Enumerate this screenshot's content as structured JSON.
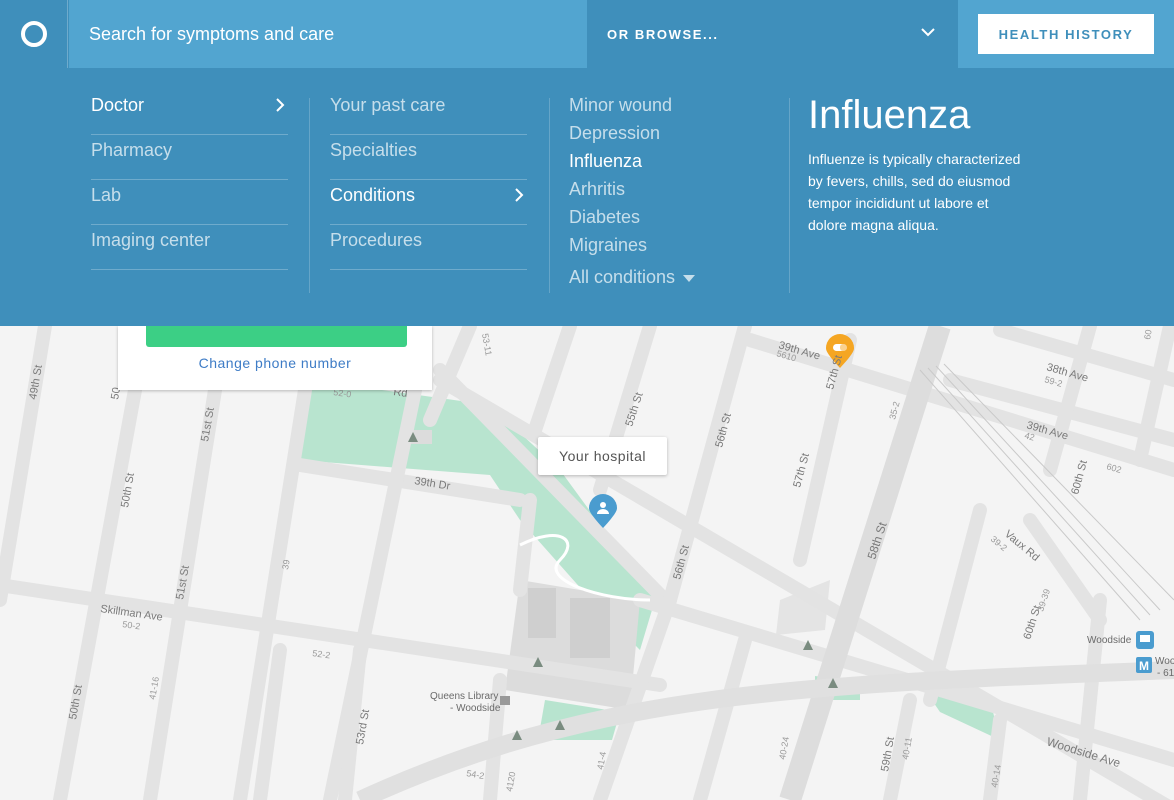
{
  "header": {
    "search_placeholder": "Search for symptoms and care",
    "browse_label": "OR BROWSE...",
    "history_button": "HEALTH HISTORY"
  },
  "menu": {
    "care_types": [
      {
        "label": "Doctor",
        "active": true
      },
      {
        "label": "Pharmacy",
        "active": false
      },
      {
        "label": "Lab",
        "active": false
      },
      {
        "label": "Imaging center",
        "active": false
      }
    ],
    "doctor_options": [
      {
        "label": "Your past care",
        "active": false
      },
      {
        "label": "Specialties",
        "active": false
      },
      {
        "label": "Conditions",
        "active": true
      },
      {
        "label": "Procedures",
        "active": false
      }
    ],
    "conditions": [
      {
        "label": "Minor wound",
        "active": false
      },
      {
        "label": "Depression",
        "active": false
      },
      {
        "label": "Influenza",
        "active": true
      },
      {
        "label": "Arhritis",
        "active": false
      },
      {
        "label": "Diabetes",
        "active": false
      },
      {
        "label": "Migraines",
        "active": false
      }
    ],
    "all_conditions": "All conditions"
  },
  "detail": {
    "title": "Influenza",
    "description": "Influenze is typically characterized by fevers, chills, sed do eiusmod tempor incididunt ut labore et dolore magna aliqua."
  },
  "card": {
    "change_phone": "Change phone number"
  },
  "map": {
    "hospital_callout": "Your hospital",
    "street_labels": [
      {
        "text": "49th St"
      },
      {
        "text": "50th St"
      },
      {
        "text": "51st St"
      },
      {
        "text": "50th St"
      },
      {
        "text": "51st St"
      },
      {
        "text": "53rd St"
      },
      {
        "text": "55th St"
      },
      {
        "text": "56th St"
      },
      {
        "text": "56th St"
      },
      {
        "text": "57th St"
      },
      {
        "text": "57th St"
      },
      {
        "text": "58th St"
      },
      {
        "text": "59th St"
      },
      {
        "text": "60th St"
      },
      {
        "text": "60th St"
      },
      {
        "text": "39th Ave"
      },
      {
        "text": "39th Ave"
      },
      {
        "text": "38th Ave"
      },
      {
        "text": "39th Dr"
      },
      {
        "text": "Skillman Ave"
      },
      {
        "text": "Woodside Ave"
      },
      {
        "text": "Vaux Rd"
      },
      {
        "text": "Rd"
      },
      {
        "text": "50"
      }
    ],
    "numbers": [
      {
        "text": "53-11"
      },
      {
        "text": "5610"
      },
      {
        "text": "35-2"
      },
      {
        "text": "59-2"
      },
      {
        "text": "42"
      },
      {
        "text": "602"
      },
      {
        "text": "60"
      },
      {
        "text": "39-2"
      },
      {
        "text": "39-39"
      },
      {
        "text": "50-2"
      },
      {
        "text": "52-2"
      },
      {
        "text": "52-0"
      },
      {
        "text": "41-16"
      },
      {
        "text": "39"
      },
      {
        "text": "54-2"
      },
      {
        "text": "4120"
      },
      {
        "text": "41-4"
      },
      {
        "text": "40-24"
      },
      {
        "text": "40-11"
      },
      {
        "text": "40-14"
      }
    ],
    "library_line1": "Queens Library",
    "library_line2": "- Woodside",
    "station_label": "Woodside",
    "station_label2": "Woo",
    "station_line": "- 61"
  },
  "colors": {
    "header_blue": "#3f8fbb",
    "search_blue": "#52a5d0",
    "hospital_pin": "#4a9ccf",
    "pharmacy_pin": "#f5a623",
    "park_green": "#b8e4cf",
    "phone_green": "#3ccf85"
  },
  "icons": {
    "logo": "circle-logo-icon",
    "browse": "chevron-down-icon",
    "arrow": "chevron-right-icon",
    "pin": "hospital-pin-icon",
    "pharmacy": "pharmacy-pin-icon",
    "train": "train-icon",
    "metro": "metro-icon",
    "tree": "tree-icon",
    "library": "library-icon"
  }
}
